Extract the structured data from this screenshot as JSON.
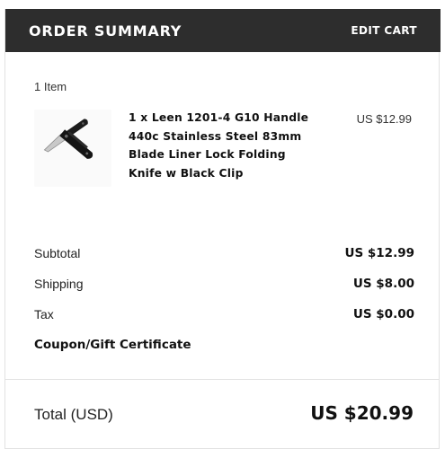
{
  "header": {
    "title": "ORDER SUMMARY",
    "edit_cart_label": "EDIT CART"
  },
  "cart": {
    "item_count": "1 Item",
    "items": [
      {
        "name": "1 x Leen 1201-4 G10 Handle 440c Stainless Steel 83mm Blade Liner Lock Folding Knife w Black Clip",
        "price": "US $12.99",
        "thumbnail_icon": "folding-knife-image"
      }
    ]
  },
  "summary": {
    "subtotal_label": "Subtotal",
    "subtotal_value": "US $12.99",
    "shipping_label": "Shipping",
    "shipping_value": "US $8.00",
    "tax_label": "Tax",
    "tax_value": "US $0.00",
    "coupon_label": "Coupon/Gift Certificate"
  },
  "total": {
    "label": "Total (USD)",
    "value": "US $20.99"
  }
}
